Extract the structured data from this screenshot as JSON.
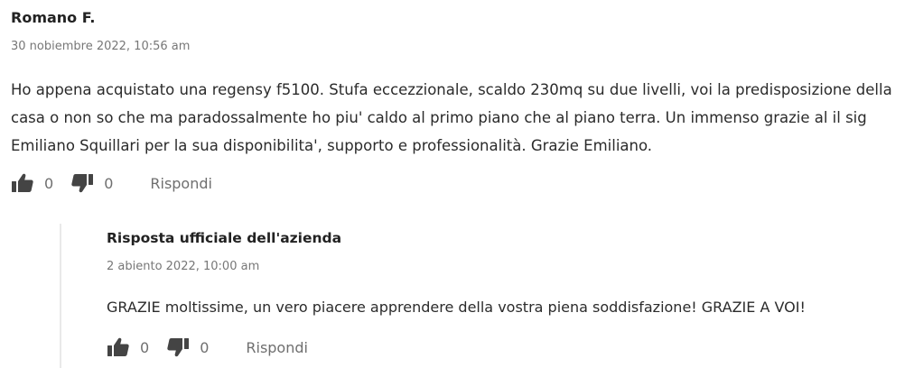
{
  "comment": {
    "author": "Romano F.",
    "date": "30 nobiembre 2022, 10:56 am",
    "text": "Ho appena acquistato una regensy f5100. Stufa eccezzionale, scaldo 230mq su due livelli, voi la predisposizione della casa o non so che ma paradossalmente ho piu' caldo al primo piano che al piano terra. Un immenso grazie al il sig Emiliano Squillari per la sua disponibilita', supporto e professionalità. Grazie Emiliano.",
    "likes": "0",
    "dislikes": "0",
    "reply_label": "Rispondi"
  },
  "reply": {
    "author": "Risposta ufficiale dell'azienda",
    "date": "2 abiento 2022, 10:00 am",
    "text": "GRAZIE moltissime, un vero piacere apprendere della vostra piena soddisfazione! GRAZIE A VOI!",
    "likes": "0",
    "dislikes": "0",
    "reply_label": "Rispondi"
  },
  "icons": {
    "like": "thumbs-up-icon",
    "dislike": "thumbs-down-icon"
  },
  "colors": {
    "icon": "#444444",
    "text": "#2b2b2b",
    "muted": "#777777",
    "thread_line": "#e9e9e9"
  }
}
